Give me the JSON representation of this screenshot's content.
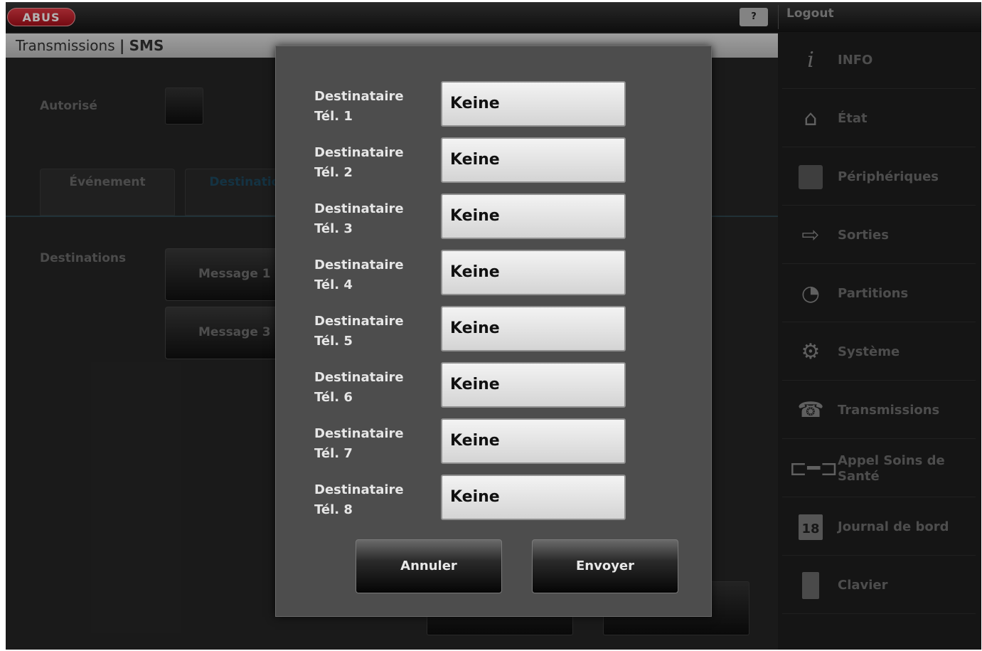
{
  "header": {
    "logo": "ABUS",
    "help_label": "?",
    "logout_label": "Logout"
  },
  "breadcrumb": {
    "section": "Transmissions",
    "separator": "|",
    "page": "SMS"
  },
  "background": {
    "autorise_label": "Autorisé",
    "tabs": [
      "Événement",
      "Destinations"
    ],
    "destinations_label": "Destinations",
    "message_buttons": [
      "Message 1",
      "Message 3"
    ]
  },
  "sidebar": {
    "items": [
      {
        "label": "INFO",
        "icon": "info-icon"
      },
      {
        "label": "État",
        "icon": "home-icon"
      },
      {
        "label": "Périphériques",
        "icon": "device-icon"
      },
      {
        "label": "Sorties",
        "icon": "exit-icon"
      },
      {
        "label": "Partitions",
        "icon": "partitions-icon"
      },
      {
        "label": "Système",
        "icon": "gear-icon"
      },
      {
        "label": "Transmissions",
        "icon": "phone-icon"
      },
      {
        "label": "Appel Soins de Santé",
        "icon": "bed-icon"
      },
      {
        "label": "Journal de bord",
        "icon": "calendar-icon",
        "calendar_day": "18"
      },
      {
        "label": "Clavier",
        "icon": "keypad-icon"
      }
    ]
  },
  "dialog": {
    "recipients": [
      {
        "label": "Destinataire Tél. 1",
        "value": "Keine"
      },
      {
        "label": "Destinataire Tél. 2",
        "value": "Keine"
      },
      {
        "label": "Destinataire Tél. 3",
        "value": "Keine"
      },
      {
        "label": "Destinataire Tél. 4",
        "value": "Keine"
      },
      {
        "label": "Destinataire Tél. 5",
        "value": "Keine"
      },
      {
        "label": "Destinataire Tél. 6",
        "value": "Keine"
      },
      {
        "label": "Destinataire Tél. 7",
        "value": "Keine"
      },
      {
        "label": "Destinataire Tél. 8",
        "value": "Keine"
      }
    ],
    "cancel_label": "Annuler",
    "send_label": "Envoyer"
  }
}
